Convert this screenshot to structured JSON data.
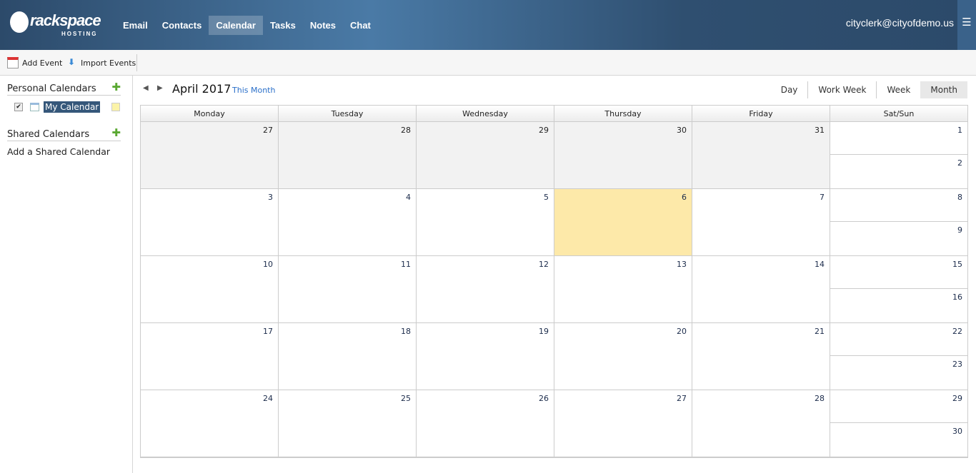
{
  "header": {
    "logo": "rackspace",
    "logo_sub": "HOSTING",
    "nav": [
      "Email",
      "Contacts",
      "Calendar",
      "Tasks",
      "Notes",
      "Chat"
    ],
    "active": "Calendar",
    "user": "cityclerk@cityofdemo.us"
  },
  "toolbar": {
    "add_event": "Add Event",
    "import_events": "Import Events"
  },
  "sidebar": {
    "personal": "Personal Calendars",
    "my_calendar": "My Calendar",
    "shared": "Shared Calendars",
    "add_shared": "Add a Shared Calendar"
  },
  "calendar": {
    "title": "April 2017",
    "this_month": "This Month",
    "views": [
      "Day",
      "Work Week",
      "Week",
      "Month"
    ],
    "selected_view": "Month",
    "days": [
      "Monday",
      "Tuesday",
      "Wednesday",
      "Thursday",
      "Friday",
      "Sat/Sun"
    ],
    "weeks": [
      {
        "wd": [
          "27",
          "28",
          "29",
          "30",
          "31"
        ],
        "sat": "1",
        "sun": "2",
        "other": true
      },
      {
        "wd": [
          "3",
          "4",
          "5",
          "6",
          "7"
        ],
        "sat": "8",
        "sun": "9"
      },
      {
        "wd": [
          "10",
          "11",
          "12",
          "13",
          "14"
        ],
        "sat": "15",
        "sun": "16"
      },
      {
        "wd": [
          "17",
          "18",
          "19",
          "20",
          "21"
        ],
        "sat": "22",
        "sun": "23"
      },
      {
        "wd": [
          "24",
          "25",
          "26",
          "27",
          "28"
        ],
        "sat": "29",
        "sun": "30"
      }
    ],
    "today": "6"
  }
}
